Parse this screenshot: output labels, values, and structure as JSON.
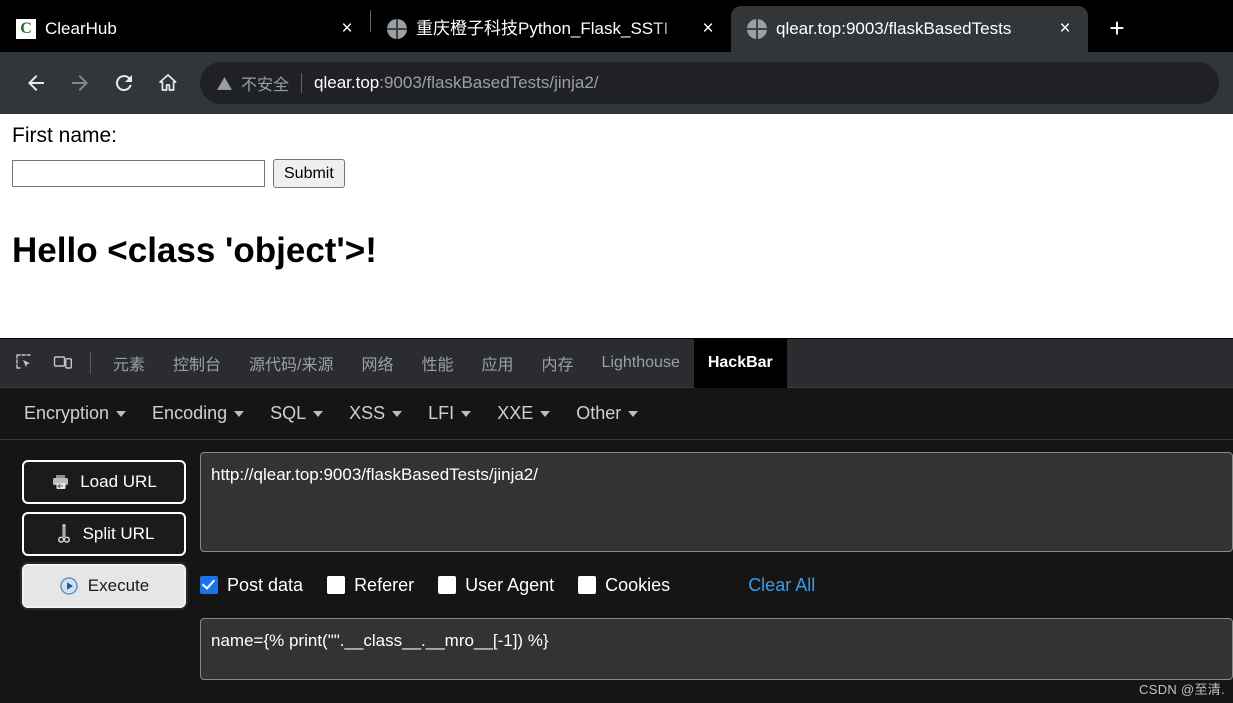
{
  "browser": {
    "tabs": [
      {
        "title": "ClearHub",
        "favicon": "clearhub-favicon",
        "active": false,
        "close_label": "×"
      },
      {
        "title": "重庆橙子科技Python_Flask_SSTI",
        "favicon": "globe-icon",
        "active": false,
        "close_label": "×"
      },
      {
        "title": "qlear.top:9003/flaskBasedTests",
        "favicon": "globe-icon",
        "active": true,
        "close_label": "×"
      }
    ],
    "new_tab_label": "+",
    "nav": {
      "back": "back-arrow-icon",
      "forward": "forward-arrow-icon",
      "reload": "reload-icon",
      "home": "home-icon"
    },
    "omnibox": {
      "security_label": "不安全",
      "url_host": "qlear.top",
      "url_rest": ":9003/flaskBasedTests/jinja2/"
    }
  },
  "page": {
    "first_name_label": "First name:",
    "first_name_value": "",
    "first_name_placeholder": "",
    "submit_label": "Submit",
    "heading": "Hello <class 'object'>!"
  },
  "devtools": {
    "inspect_icon": "inspect-element-icon",
    "device_icon": "device-toolbar-icon",
    "tabs": [
      {
        "label": "元素",
        "selected": false
      },
      {
        "label": "控制台",
        "selected": false
      },
      {
        "label": "源代码/来源",
        "selected": false
      },
      {
        "label": "网络",
        "selected": false
      },
      {
        "label": "性能",
        "selected": false
      },
      {
        "label": "应用",
        "selected": false
      },
      {
        "label": "内存",
        "selected": false
      },
      {
        "label": "Lighthouse",
        "selected": false
      },
      {
        "label": "HackBar",
        "selected": true
      }
    ]
  },
  "hackbar": {
    "menus": [
      {
        "label": "Encryption"
      },
      {
        "label": "Encoding"
      },
      {
        "label": "SQL"
      },
      {
        "label": "XSS"
      },
      {
        "label": "LFI"
      },
      {
        "label": "XXE"
      },
      {
        "label": "Other"
      }
    ],
    "buttons": [
      {
        "label": "Load URL",
        "icon": "load-url-icon"
      },
      {
        "label": "Split URL",
        "icon": "split-url-icon"
      },
      {
        "label": "Execute",
        "icon": "execute-play-icon"
      }
    ],
    "url_value": "http://qlear.top:9003/flaskBasedTests/jinja2/",
    "options": [
      {
        "label": "Post data",
        "checked": true
      },
      {
        "label": "Referer",
        "checked": false
      },
      {
        "label": "User Agent",
        "checked": false
      },
      {
        "label": "Cookies",
        "checked": false
      }
    ],
    "clear_all_label": "Clear All",
    "post_data_value": "name={% print(\"\".__class__.__mro__[-1]) %}"
  },
  "watermark": "CSDN @至清.",
  "colors": {
    "accent_blue": "#1a73e8",
    "link_blue": "#3d9ae8",
    "tab_active_bg": "#323639",
    "devtools_bg": "#1e1e1e"
  }
}
